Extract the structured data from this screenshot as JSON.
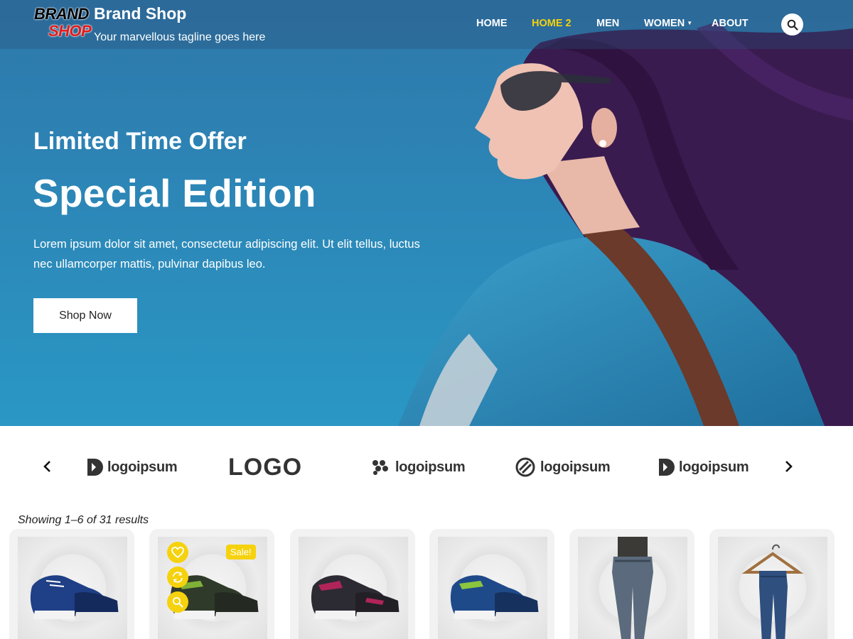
{
  "site": {
    "logo_line1": "BRAND",
    "logo_line2": "SHOP",
    "title": "Brand Shop",
    "tagline": "Your marvellous tagline goes here"
  },
  "nav": {
    "items": [
      {
        "label": "HOME",
        "active": false
      },
      {
        "label": "HOME 2",
        "active": true
      },
      {
        "label": "MEN",
        "active": false
      },
      {
        "label": "WOMEN",
        "active": false,
        "has_dropdown": true
      },
      {
        "label": "ABOUT",
        "active": false
      }
    ],
    "search_icon": "search-icon",
    "active_color": "#f5d20d"
  },
  "hero": {
    "kicker": "Limited Time Offer",
    "title": "Special Edition",
    "text": "Lorem ipsum dolor sit amet, consectetur adipiscing elit. Ut elit tellus, luctus nec ullamcorper mattis, pulvinar dapibus leo.",
    "button": "Shop Now",
    "background_color": "#2f8bbd"
  },
  "brands": {
    "prev_icon": "chevron-left-icon",
    "next_icon": "chevron-right-icon",
    "logos": [
      {
        "text": "logoipsum"
      },
      {
        "text": "LOGO"
      },
      {
        "text": "logoipsum"
      },
      {
        "text": "logoipsum"
      },
      {
        "text": "logoipsum"
      }
    ]
  },
  "products": {
    "results_text": "Showing 1–6 of 31 results",
    "sale_label": "Sale!",
    "accent_color": "#f5d20d",
    "items": [
      {
        "image": "sneaker-blue"
      },
      {
        "image": "sneaker-green",
        "sale": true,
        "actions": [
          "heart-icon",
          "compare-icon",
          "zoom-icon"
        ]
      },
      {
        "image": "sneaker-pink"
      },
      {
        "image": "sneaker-blue-green"
      },
      {
        "image": "jeans-model"
      },
      {
        "image": "jeans-hanger"
      }
    ]
  }
}
